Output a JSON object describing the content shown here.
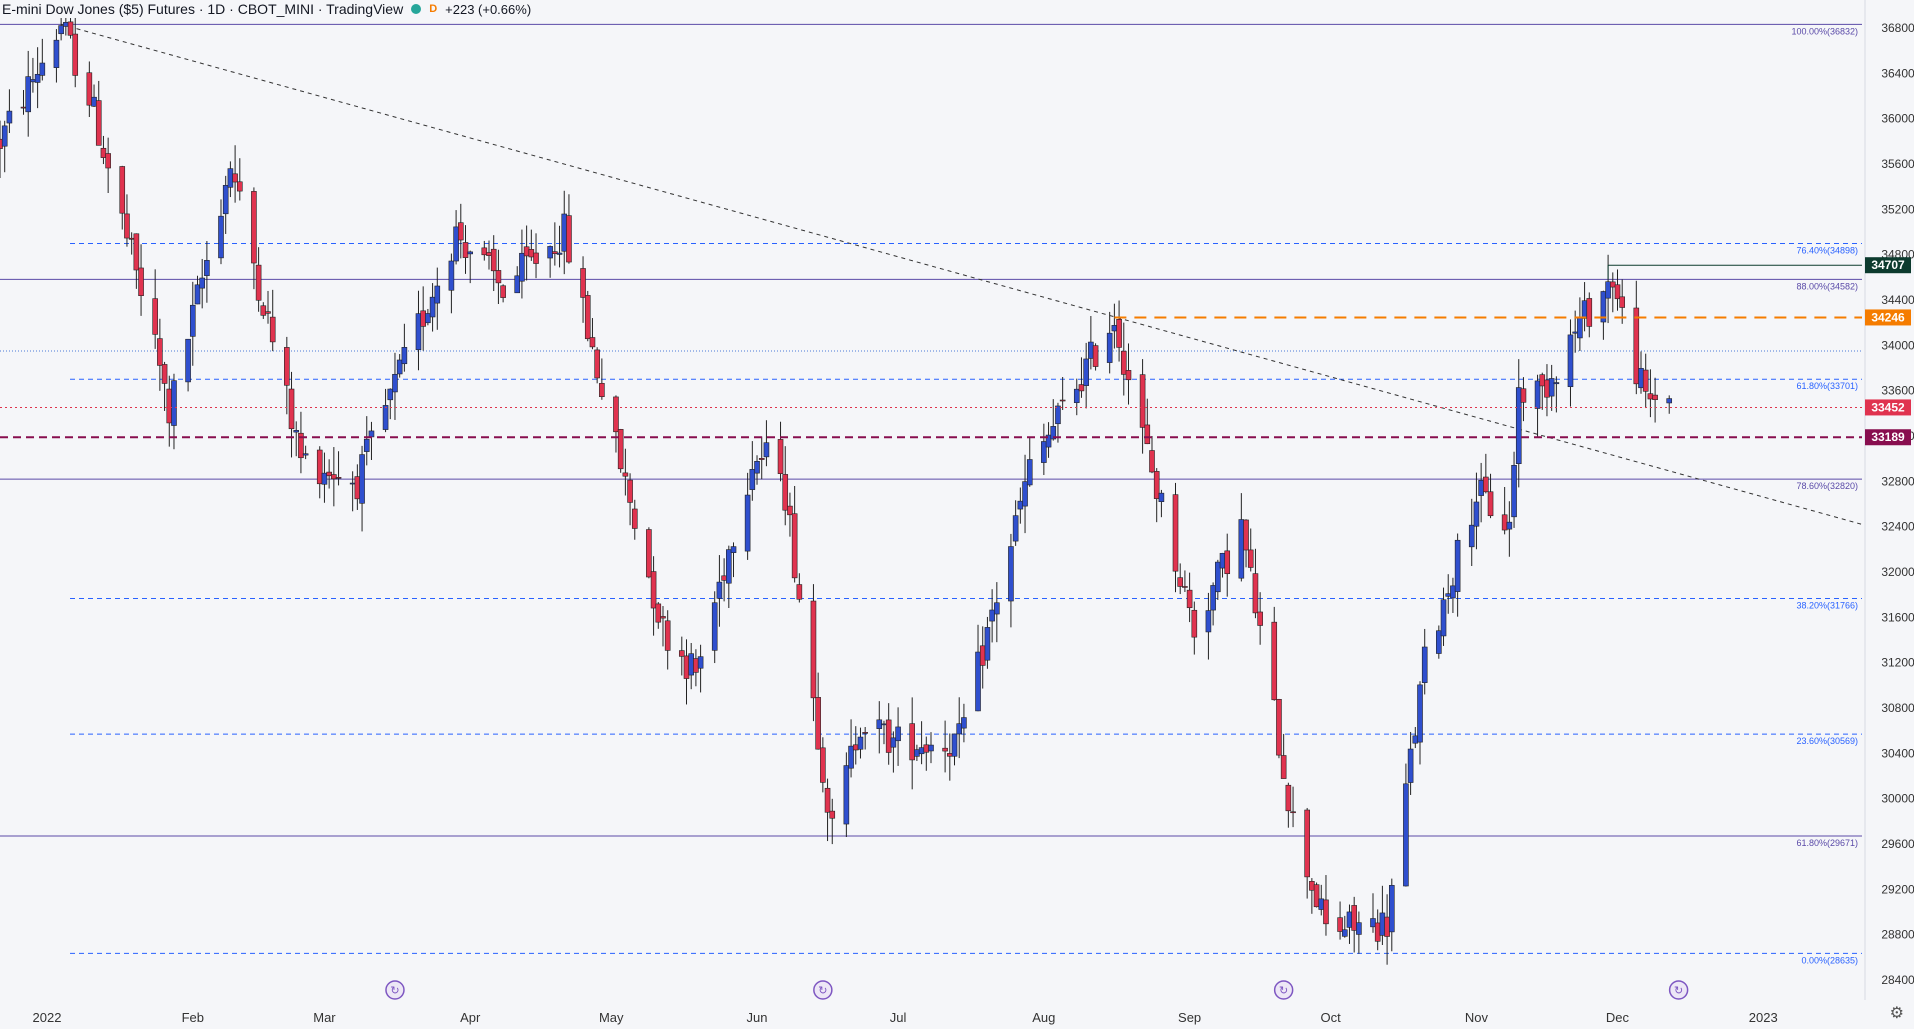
{
  "header": {
    "title": "E-mini Dow Jones ($5) Futures · 1D · CBOT_MINI · TradingView",
    "badge": "D",
    "change": "+223 (+0.66%)",
    "dot_green": "#26a69a",
    "dot_orange": "#f57c00"
  },
  "icons": {
    "settings": "gear-icon",
    "event": "recurring-event-icon"
  },
  "colors": {
    "up": "#2f4fce",
    "down": "#e0334f",
    "background": "#f5f6f9",
    "fib": "#2962ff",
    "fib_purple": "#5a4aa8",
    "orange": "#f57c00",
    "red_level": "#e0334f",
    "maroon_level": "#880e4f",
    "dark_green": "#0d3b2e"
  },
  "chart_data": {
    "type": "candlestick",
    "symbol": "E-mini Dow Jones ($5) Futures",
    "interval": "1D",
    "ylim": [
      28400,
      36800
    ],
    "y_ticks": [
      28400,
      28800,
      29200,
      29600,
      30000,
      30400,
      30800,
      31200,
      31600,
      32000,
      32400,
      32800,
      33200,
      33600,
      34000,
      34400,
      34800,
      35200,
      35600,
      36000,
      36400,
      36800
    ],
    "x_ticks": [
      {
        "label": "2022",
        "date": "2022-01-01"
      },
      {
        "label": "Feb",
        "date": "2022-02-01"
      },
      {
        "label": "Mar",
        "date": "2022-03-01"
      },
      {
        "label": "Apr",
        "date": "2022-04-01"
      },
      {
        "label": "May",
        "date": "2022-05-01"
      },
      {
        "label": "Jun",
        "date": "2022-06-01"
      },
      {
        "label": "Jul",
        "date": "2022-07-01"
      },
      {
        "label": "Aug",
        "date": "2022-08-01"
      },
      {
        "label": "Sep",
        "date": "2022-09-01"
      },
      {
        "label": "Oct",
        "date": "2022-10-01"
      },
      {
        "label": "Nov",
        "date": "2022-11-01"
      },
      {
        "label": "Dec",
        "date": "2022-12-01"
      },
      {
        "label": "2023",
        "date": "2023-01-01"
      }
    ],
    "x_range": [
      "2021-12-22",
      "2023-01-22"
    ],
    "anchors": [
      [
        "2021-12-22",
        35800
      ],
      [
        "2022-01-04",
        36832
      ],
      [
        "2022-01-10",
        36200
      ],
      [
        "2022-01-24",
        34000
      ],
      [
        "2022-01-27",
        33400
      ],
      [
        "2022-02-09",
        35600
      ],
      [
        "2022-02-24",
        33000
      ],
      [
        "2022-03-08",
        32800
      ],
      [
        "2022-03-29",
        35000
      ],
      [
        "2022-04-08",
        34500
      ],
      [
        "2022-04-21",
        35000
      ],
      [
        "2022-05-02",
        33100
      ],
      [
        "2022-05-12",
        31500
      ],
      [
        "2022-05-19",
        31100
      ],
      [
        "2022-05-31",
        33000
      ],
      [
        "2022-06-06",
        33000
      ],
      [
        "2022-06-17",
        29700
      ],
      [
        "2022-06-23",
        30700
      ],
      [
        "2022-06-30",
        30500
      ],
      [
        "2022-07-14",
        30500
      ],
      [
        "2022-07-29",
        32900
      ],
      [
        "2022-08-16",
        34250
      ],
      [
        "2022-08-22",
        33200
      ],
      [
        "2022-09-02",
        31500
      ],
      [
        "2022-09-12",
        32400
      ],
      [
        "2022-09-23",
        29800
      ],
      [
        "2022-09-30",
        28850
      ],
      [
        "2022-10-13",
        28900
      ],
      [
        "2022-10-21",
        31200
      ],
      [
        "2022-11-01",
        32700
      ],
      [
        "2022-11-08",
        32400
      ],
      [
        "2022-11-10",
        33600
      ],
      [
        "2022-11-15",
        33600
      ],
      [
        "2022-11-23",
        34200
      ],
      [
        "2022-11-30",
        34600
      ],
      [
        "2022-12-01",
        34400
      ],
      [
        "2022-12-07",
        33500
      ],
      [
        "2022-12-12",
        33600
      ]
    ],
    "horizontal_levels": [
      {
        "label": "100.00%(36832)",
        "value": 36832,
        "style": "solid",
        "color": "#5a4aa8"
      },
      {
        "label": "76.40%(34898)",
        "value": 34898,
        "style": "dashed",
        "color": "#2962ff"
      },
      {
        "label": "88.00%(34582)",
        "value": 34582,
        "style": "solid",
        "color": "#5a4aa8"
      },
      {
        "label": "61.80%(33701)",
        "value": 33701,
        "style": "dashed",
        "color": "#2962ff"
      },
      {
        "label": "78.60%(32820)",
        "value": 32820,
        "style": "solid",
        "color": "#5a4aa8"
      },
      {
        "label": "38.20%(31766)",
        "value": 31766,
        "style": "dashed",
        "color": "#2962ff"
      },
      {
        "label": "23.60%(30569)",
        "value": 30569,
        "style": "dashed",
        "color": "#2962ff"
      },
      {
        "label": "61.80%(29671)",
        "value": 29671,
        "style": "solid",
        "color": "#5a4aa8"
      },
      {
        "label": "0.00%(28635)",
        "value": 28635,
        "style": "dashed",
        "color": "#2962ff"
      }
    ],
    "price_tags": [
      {
        "label": "34707",
        "value": 34707,
        "color": "#0d3b2e",
        "line": "solid",
        "from": "2022-11-29"
      },
      {
        "label": "34246",
        "value": 34246,
        "color": "#f57c00",
        "line": "longdash",
        "from": "2022-08-16"
      },
      {
        "label": "33452",
        "value": 33452,
        "color": "#e0334f",
        "line": "dotted",
        "from": null
      },
      {
        "label": "33189",
        "value": 33189,
        "color": "#880e4f",
        "line": "dashed",
        "from": null
      }
    ],
    "dotted_blue_level": 33950,
    "trendline": {
      "start": [
        "2022-01-04",
        36832
      ],
      "end": [
        "2023-01-22",
        32420
      ],
      "style": "dashed"
    },
    "event_markers": [
      "2022-03-16",
      "2022-06-15",
      "2022-09-21",
      "2022-12-14"
    ]
  }
}
